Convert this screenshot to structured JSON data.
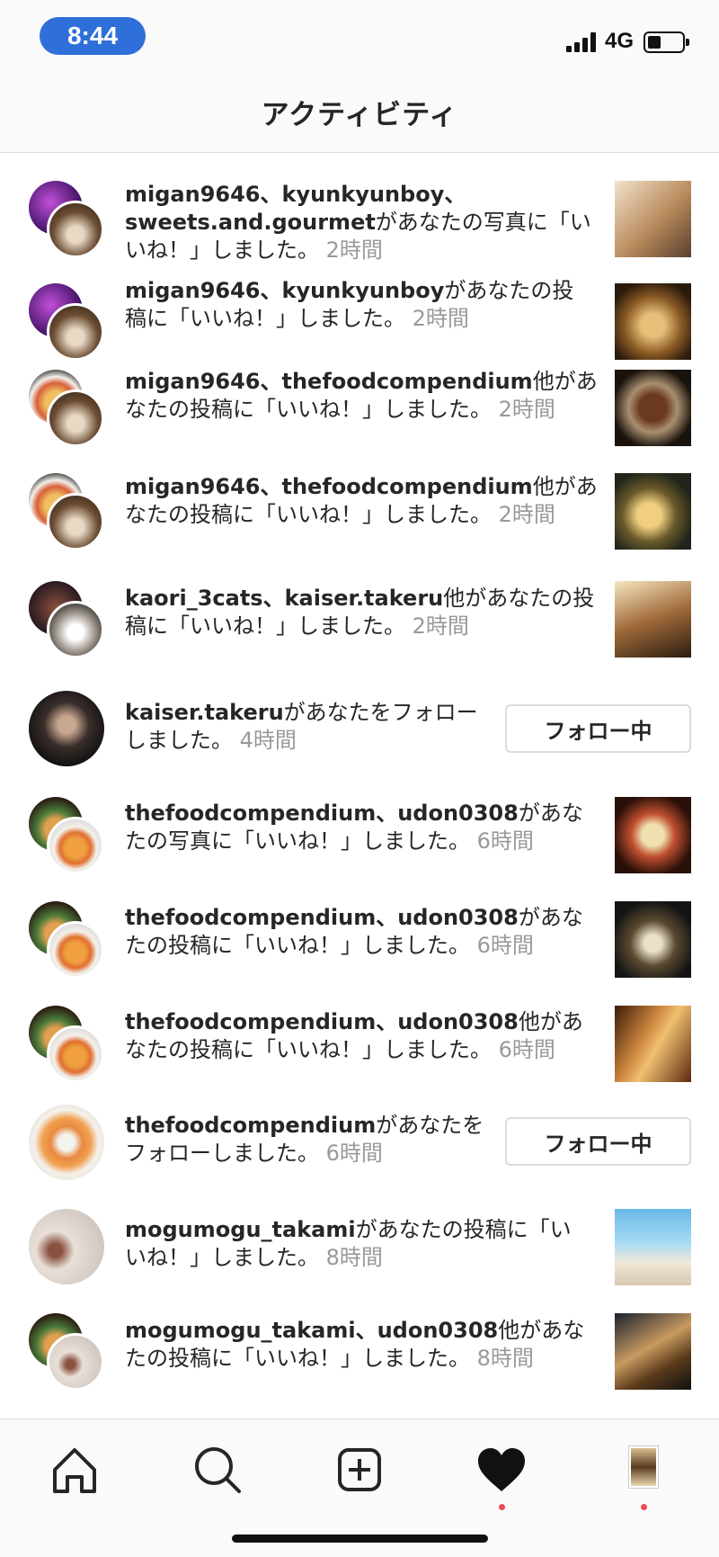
{
  "status_bar": {
    "time": "8:44",
    "network": "4G"
  },
  "header": {
    "title": "アクティビティ"
  },
  "rows": [
    {
      "users": "migan9646、kyunkyunboy、sweets.and.gourmet",
      "text_before": "",
      "message": "があなたの写真に「いいね！」しました。",
      "time": "2時間"
    },
    {
      "users": "migan9646、kyunkyunboy",
      "message": "があなたの投稿に「いいね！」しました。",
      "time": "2時間"
    },
    {
      "users": "migan9646、thefoodcompendium",
      "message": "他があなたの投稿に「いいね！」しました。",
      "time": "2時間"
    },
    {
      "users": "migan9646、thefoodcompendium",
      "message": "他があなたの投稿に「いいね！」しました。",
      "time": "2時間"
    },
    {
      "users": "kaori_3cats、kaiser.takeru",
      "message": "他があなたの投稿に「いいね！」しました。",
      "time": "2時間"
    },
    {
      "users": "kaiser.takeru",
      "message": "があなたをフォローしました。",
      "time": "4時間",
      "button": "フォロー中"
    },
    {
      "users": "thefoodcompendium、udon0308",
      "message": "があなたの写真に「いいね！」しました。",
      "time": "6時間"
    },
    {
      "users": "thefoodcompendium、udon0308",
      "message": "があなたの投稿に「いいね！」しました。",
      "time": "6時間"
    },
    {
      "users": "thefoodcompendium、udon0308",
      "message": "他があなたの投稿に「いいね！」しました。",
      "time": "6時間"
    },
    {
      "users": "thefoodcompendium",
      "message": "があなたをフォローしました。",
      "time": "6時間",
      "button": "フォロー中"
    },
    {
      "users": "mogumogu_takami",
      "message": "があなたの投稿に「いいね！」しました。",
      "time": "8時間"
    },
    {
      "users": "mogumogu_takami、udon0308",
      "message": "他があなたの投稿に「いいね！」しました。",
      "time": "8時間"
    }
  ],
  "tab_bar": {
    "icons": [
      "home-icon",
      "search-icon",
      "new-post-icon",
      "activity-heart-icon",
      "profile-icon"
    ]
  },
  "colors": {
    "accent_blue": "#2f6fd9",
    "notification_dot": "#ed4956",
    "secondary_text": "#999999"
  }
}
